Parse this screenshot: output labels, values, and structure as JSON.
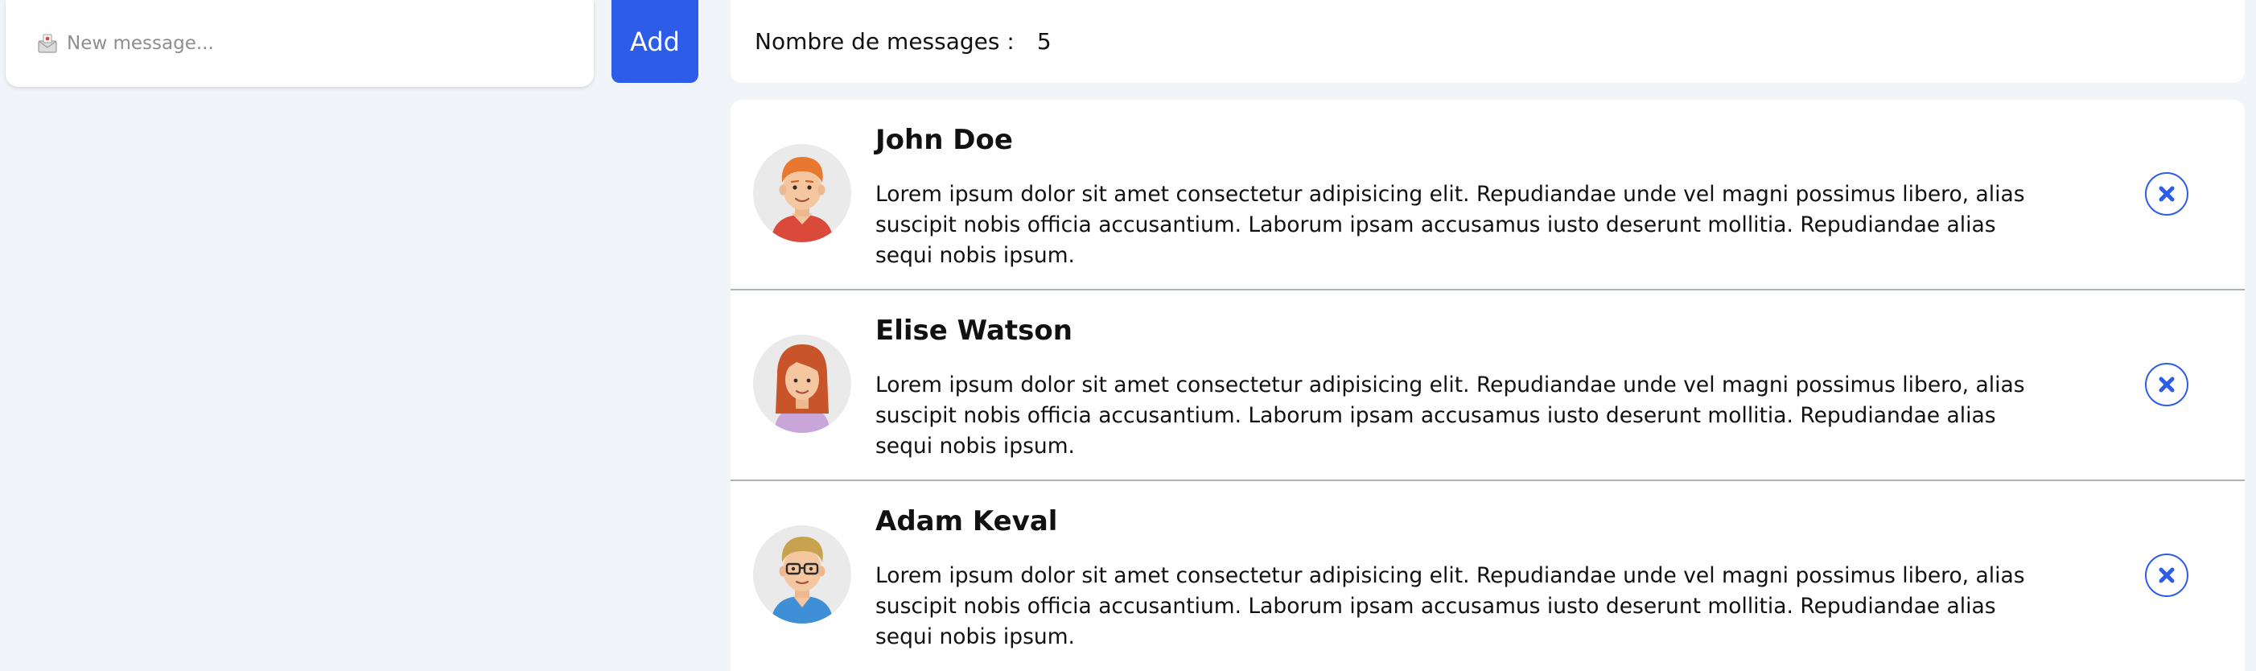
{
  "composer": {
    "placeholder": "New message...",
    "input_value": "",
    "add_label": "Add",
    "icon": "envelope-icon"
  },
  "counter": {
    "label": "Nombre de messages :",
    "value": "5"
  },
  "messages": [
    {
      "author": "John Doe",
      "body": "Lorem ipsum dolor sit amet consectetur adipisicing elit. Repudiandae unde vel magni possimus libero, alias suscipit nobis officia accusantium. Laborum ipsam accusamus iusto deserunt mollitia. Repudiandae alias sequi nobis ipsum.",
      "avatar": "male-redhead-avatar"
    },
    {
      "author": "Elise Watson",
      "body": "Lorem ipsum dolor sit amet consectetur adipisicing elit. Repudiandae unde vel magni possimus libero, alias suscipit nobis officia accusantium. Laborum ipsam accusamus iusto deserunt mollitia. Repudiandae alias sequi nobis ipsum.",
      "avatar": "female-redhead-avatar"
    },
    {
      "author": "Adam Keval",
      "body": "Lorem ipsum dolor sit amet consectetur adipisicing elit. Repudiandae unde vel magni possimus libero, alias suscipit nobis officia accusantium. Laborum ipsam accusamus iusto deserunt mollitia. Repudiandae alias sequi nobis ipsum.",
      "avatar": "male-glasses-avatar"
    }
  ],
  "colors": {
    "accent": "#2d5ce8",
    "page_background": "#f1f4f8",
    "card_background": "#ffffff",
    "divider": "#aeb3b8"
  },
  "delete_icon": "close-circle-icon"
}
